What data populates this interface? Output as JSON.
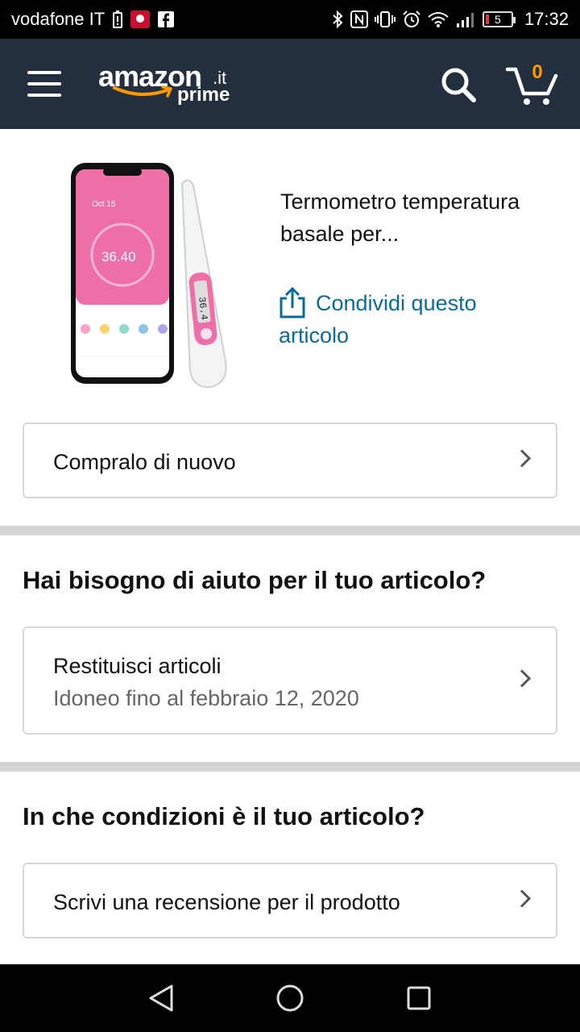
{
  "status_bar": {
    "carrier": "vodafone IT",
    "battery_level": "5",
    "time": "17:32",
    "icons": [
      "battery-alert-icon",
      "huawei-icon",
      "facebook-icon",
      "bluetooth-icon",
      "nfc-icon",
      "vibrate-icon",
      "alarm-icon",
      "wifi-icon",
      "signal-icon",
      "battery-icon"
    ]
  },
  "header": {
    "logo_word": "amazon",
    "logo_tld": ".it",
    "logo_prime": "prime",
    "cart_count": "0",
    "icons": [
      "menu-icon",
      "search-icon",
      "cart-icon"
    ]
  },
  "product": {
    "title": "Termometro temperatura basale per...",
    "share_label": "Condividi questo articolo",
    "image_texts": {
      "date": "Oct 15",
      "temperature": "36.40",
      "display": "36.4"
    },
    "colors": {
      "link": "#0a6b9a",
      "brand_orange": "#ff9900",
      "header_bg": "#232f3e"
    }
  },
  "buy_again": {
    "label": "Compralo di nuovo"
  },
  "help": {
    "title": "Hai bisogno di aiuto per il tuo articolo?",
    "return_label": "Restituisci articoli",
    "return_sub": "Idoneo fino al febbraio 12, 2020"
  },
  "condition": {
    "title": "In che condizioni è il tuo articolo?",
    "review_label": "Scrivi una recensione per il prodotto"
  },
  "nav": {
    "icons": [
      "back-icon",
      "home-icon",
      "recents-icon"
    ]
  }
}
